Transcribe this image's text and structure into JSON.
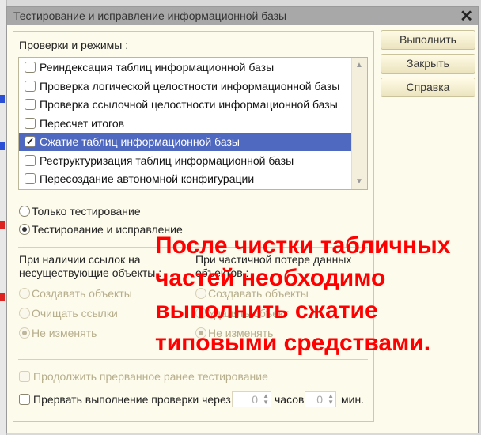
{
  "dialog": {
    "title": "Тестирование и исправление информационной базы"
  },
  "buttons": {
    "run": "Выполнить",
    "close": "Закрыть",
    "help": "Справка"
  },
  "checks_label": "Проверки и режимы :",
  "checks": [
    {
      "label": "Реиндексация таблиц информационной базы",
      "checked": false
    },
    {
      "label": "Проверка логической целостности информационной базы",
      "checked": false
    },
    {
      "label": "Проверка ссылочной целостности информационной базы",
      "checked": false
    },
    {
      "label": "Пересчет итогов",
      "checked": false
    },
    {
      "label": "Сжатие таблиц информационной базы",
      "checked": true,
      "selected": true
    },
    {
      "label": "Реструктуризация таблиц информационной базы",
      "checked": false
    },
    {
      "label": "Пересоздание автономной конфигурации",
      "checked": false
    }
  ],
  "mode": {
    "options": [
      "Только тестирование",
      "Тестирование и исправление"
    ],
    "selected": 1
  },
  "refs": {
    "label": "При наличии ссылок на несуществующие объекты :",
    "options": [
      "Создавать объекты",
      "Очищать ссылки",
      "Не изменять"
    ],
    "selected": 2
  },
  "loss": {
    "label": "При частичной потере данных объектов :",
    "options": [
      "Создавать объекты",
      "Удалять объект",
      "Не изменять"
    ],
    "selected": 2
  },
  "continue_label": "Продолжить прерванное ранее тестирование",
  "interrupt": {
    "label": "Прервать выполнение проверки через",
    "hours": "0",
    "hours_unit": "часов",
    "minutes": "0",
    "minutes_unit": "мин."
  },
  "overlay_text": [
    "После чистки табличных",
    "частей необходимо",
    "выполнить сжатие",
    "типовыми средствами."
  ],
  "colors": {
    "selection": "#4f68c0",
    "overlay": "#ff0000",
    "dialog_bg": "#fdfbec"
  }
}
